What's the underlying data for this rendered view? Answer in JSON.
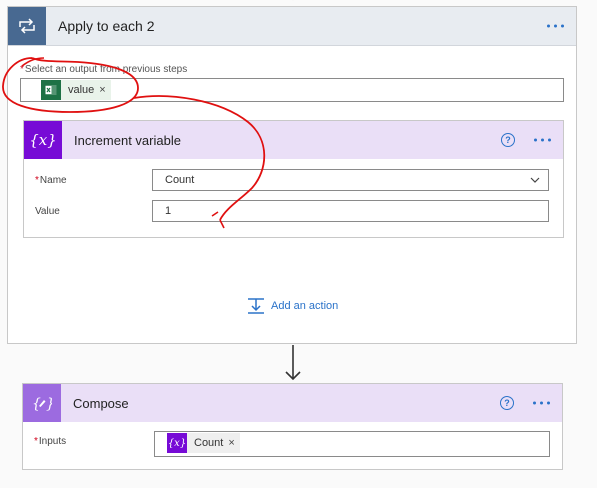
{
  "loop": {
    "title": "Apply to each 2",
    "output_label": "Select an output from previous steps",
    "required_mark": "*",
    "token": {
      "label": "value",
      "remove": "×",
      "icon": "excel-icon"
    }
  },
  "increment": {
    "title": "Increment variable",
    "help": "?",
    "name_label": "Name",
    "name_value": "Count",
    "value_label": "Value",
    "value_value": "1"
  },
  "add_action": {
    "label": "Add an action"
  },
  "compose": {
    "title": "Compose",
    "help": "?",
    "inputs_label": "Inputs",
    "token": {
      "label": "Count",
      "remove": "×",
      "icon": "variable-icon"
    }
  },
  "colors": {
    "loop_header_icon": "#486991",
    "variable_purple": "#770bd6",
    "link_blue": "#2a72c9",
    "annotation_red": "#e01010"
  }
}
